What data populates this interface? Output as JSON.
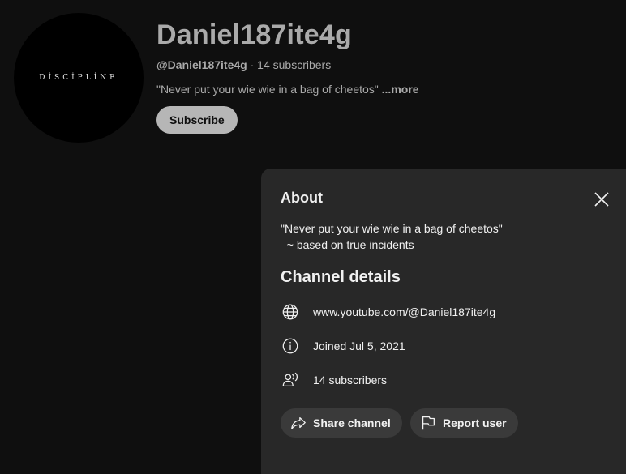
{
  "channel": {
    "avatar_text": "DİSCİPLİNE",
    "name": "Daniel187ite4g",
    "handle": "@Daniel187ite4g",
    "separator": " · ",
    "subscribers": "14 subscribers",
    "description_snippet": "\"Never put your wie wie in a bag of cheetos\"",
    "more_label": " ...more",
    "subscribe_label": "Subscribe"
  },
  "about_panel": {
    "title": "About",
    "description": "\"Never put your wie wie in a bag of cheetos\"\n  ~ based on true incidents",
    "details_title": "Channel details",
    "details": [
      {
        "icon": "globe-icon",
        "text": "www.youtube.com/@Daniel187ite4g"
      },
      {
        "icon": "info-icon",
        "text": "Joined Jul 5, 2021"
      },
      {
        "icon": "people-icon",
        "text": "14 subscribers"
      }
    ],
    "share_label": "Share channel",
    "report_label": "Report user"
  },
  "colors": {
    "background": "#0f0f0f",
    "panel": "#282828",
    "button": "#3a3a3a",
    "subscribe_button": "#b6b6b6",
    "muted_text": "#aaaaaa",
    "text": "#f1f1f1"
  }
}
